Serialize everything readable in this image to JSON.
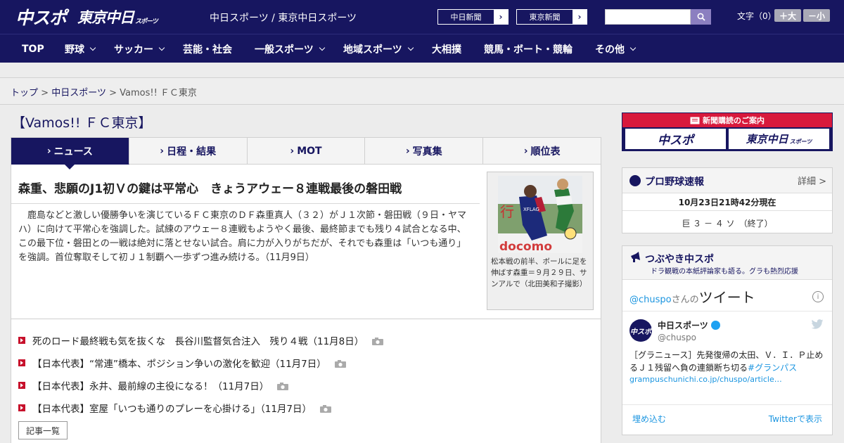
{
  "header": {
    "logo_chuspo": "中スポ",
    "logo_tokyo": "東京中日",
    "logo_tokyo_small": "スポーツ",
    "site_title": "中日スポーツ / 東京中日スポーツ",
    "ext_links": [
      {
        "label": "中日新聞"
      },
      {
        "label": "東京新聞"
      }
    ],
    "search_placeholder": "",
    "font_size_label": "文字（0）",
    "font_bigger": "＋大",
    "font_smaller": "－小"
  },
  "nav": [
    {
      "label": "TOP",
      "dropdown": false
    },
    {
      "label": "野球",
      "dropdown": true
    },
    {
      "label": "サッカー",
      "dropdown": true
    },
    {
      "label": "芸能・社会",
      "dropdown": false
    },
    {
      "label": "一般スポーツ",
      "dropdown": true
    },
    {
      "label": "地域スポーツ",
      "dropdown": true
    },
    {
      "label": "大相撲",
      "dropdown": false
    },
    {
      "label": "競馬・ボート・競輪",
      "dropdown": false
    },
    {
      "label": "その他",
      "dropdown": true
    }
  ],
  "breadcrumb": {
    "home": "トップ",
    "sep": ">",
    "section": "中日スポーツ",
    "current": "Vamos!! ＦＣ東京"
  },
  "page_heading": "【Vamos!! ＦＣ東京】",
  "tabs": [
    {
      "label": "ニュース",
      "active": true
    },
    {
      "label": "日程・結果",
      "active": false
    },
    {
      "label": "MOT",
      "active": false
    },
    {
      "label": "写真集",
      "active": false
    },
    {
      "label": "順位表",
      "active": false
    }
  ],
  "tab_marker": "›",
  "article": {
    "title": "森重、悲願のJ1初Ｖの鍵は平常心　きょうアウェー８連戦最後の磐田戦",
    "body": "鹿島などと激しい優勝争いを演じているＦＣ東京のＤＦ森重真人（３２）がＪ１次節・磐田戦（９日・ヤマハ）に向けて平常心を強調した。試練のアウェー８連戦もようやく最後、最終節までも残り４試合となる中、この最下位・磐田との一戦は絶対に落とせない試合。肩に力が入りがちだが、それでも森重は「いつも通り」を強調。首位奪取そして初Ｊ１制覇へ一歩ずつ進み続ける。（11月9日）",
    "photo_caption": "松本戦の前半、ボールに足を伸ばす森重＝９月２９日、サンアルで（北田美和子撮影）",
    "photo_text_top": "行",
    "photo_text_jersey": "XFLAG",
    "photo_text_bottom": "docomo"
  },
  "related": [
    {
      "text": "死のロード最終戦も気を抜くな　長谷川監督気合注入　残り４戦（11月8日）"
    },
    {
      "text": "【日本代表】“常連”橋本、ポジション争いの激化を歓迎（11月7日）"
    },
    {
      "text": "【日本代表】永井、最前線の主役になる！（11月7日）"
    },
    {
      "text": "【日本代表】室屋「いつも通りのプレーを心掛ける」（11月7日）"
    }
  ],
  "more_button": "記事一覧",
  "sidebar": {
    "subscribe_head": "新聞購読のご案内",
    "sub_logo_1": "中スポ",
    "sub_logo_2": "東京中日",
    "sub_logo_2_small": "スポーツ",
    "baseball": {
      "title": "プロ野球速報",
      "detail": "詳細 >",
      "time": "10月23日21時42分現在",
      "score": "巨 ３ － ４ ソ　（終了）"
    },
    "tsubuyaki": {
      "title": "つぶやき中スポ",
      "subtitle": "ドラ観戦の本紙評論家も語る。グラも熱烈応援",
      "handle_link": "@chuspo",
      "handle_suffix": "さんの",
      "tweets_label": "ツイート",
      "info_icon": "i",
      "account_name": "中日スポーツ",
      "account_handle": "@chuspo",
      "avatar_text": "中スポ",
      "tweet_text": "［グラニュース］先発復帰の太田、Ｖ．Ｉ．Ｐ止めるＪ１残留へ負の連鎖断ち切る",
      "tweet_tag_inline": "#グランパス",
      "tweet_tag": "#グランパス",
      "tweet_link": "grampuschunichi.co.jp/chuspo/article…",
      "embed": "埋め込む",
      "view_on_twitter": "Twitterで表示"
    }
  },
  "colors": {
    "brand_navy": "#171660",
    "accent_red": "#c7102b",
    "link_blue": "#1b95e0"
  }
}
